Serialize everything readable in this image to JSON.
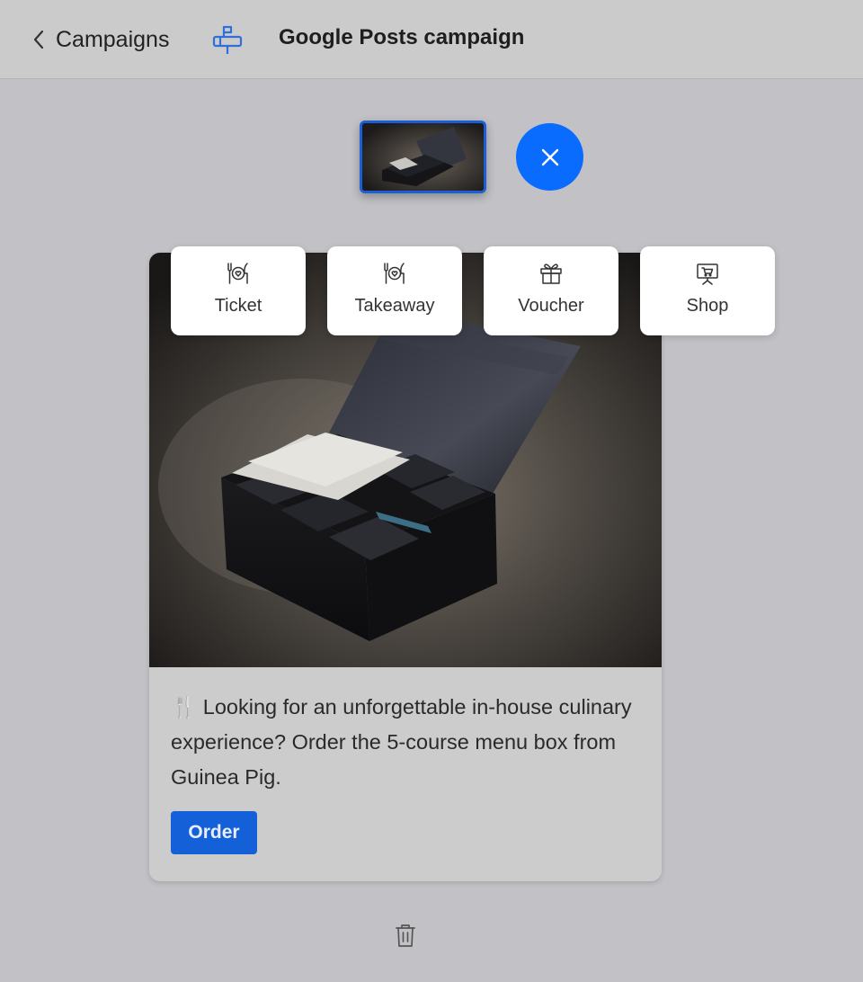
{
  "header": {
    "back_label": "Campaigns",
    "title": "Google Posts campaign"
  },
  "post_types": [
    {
      "label": "Ticket",
      "icon": "cutlery-heart-icon"
    },
    {
      "label": "Takeaway",
      "icon": "cutlery-heart-icon"
    },
    {
      "label": "Voucher",
      "icon": "gift-icon"
    },
    {
      "label": "Shop",
      "icon": "shop-cart-icon"
    }
  ],
  "post": {
    "text": "🍴 Looking for an unforgettable in-house culinary experience? Order the 5-course menu box from Guinea Pig.",
    "button_label": "Order"
  },
  "colors": {
    "accent": "#0a6cff",
    "button": "#1460d8",
    "campaign_icon": "#2e6fd8"
  }
}
